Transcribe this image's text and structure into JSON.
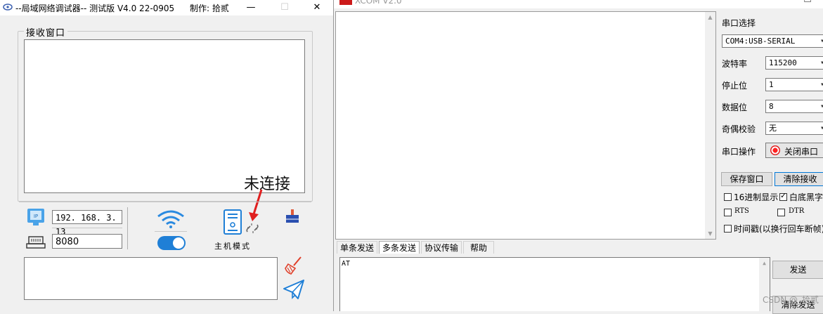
{
  "left_window": {
    "title": "--局域网络调试器-- 测试版  V4.0 22-0905",
    "author": "制作: 拾贰",
    "minimize": "—",
    "maximize": "☐",
    "close": "✕",
    "receive_label": "接收窗口",
    "annotation": "未连接",
    "ip_address": "192. 168. 3. 13",
    "port": "8080",
    "connection_toggle": "on",
    "mode_label": "主机模式",
    "icons": [
      "app-icon",
      "ip-icon",
      "port-icon",
      "wifi-icon",
      "server-icon",
      "broken-link-icon",
      "clear-icon",
      "broom-icon",
      "send-icon"
    ],
    "colors": {
      "accent": "#1f7fd6",
      "annotation": "#e02020"
    }
  },
  "right_window": {
    "title": "XCOM V2.0",
    "minimize": "—",
    "maximize": "☐",
    "serial_select_label": "串口选择",
    "port_value": "COM4:USB-SERIAL",
    "baud_label": "波特率",
    "baud_value": "115200",
    "stop_bits_label": "停止位",
    "stop_bits_value": "1",
    "data_bits_label": "数据位",
    "data_bits_value": "8",
    "parity_label": "奇偶校验",
    "parity_value": "无",
    "serial_op_label": "串口操作",
    "close_serial": "关闭串口",
    "save_window": "保存窗口",
    "clear_receive": "清除接收",
    "hex_display": "16进制显示",
    "white_bg": "白底黑字",
    "rts": "RTS",
    "dtr": "DTR",
    "timestamp": "时间戳(以换行回车断帧)",
    "tabs": [
      "单条发送",
      "多条发送",
      "协议传输",
      "帮助"
    ],
    "active_tab": "多条发送",
    "send_text": "AT",
    "send_button": "发送",
    "clear_send_button": "清除发送",
    "watermark": "CSDN @_拾贰"
  }
}
